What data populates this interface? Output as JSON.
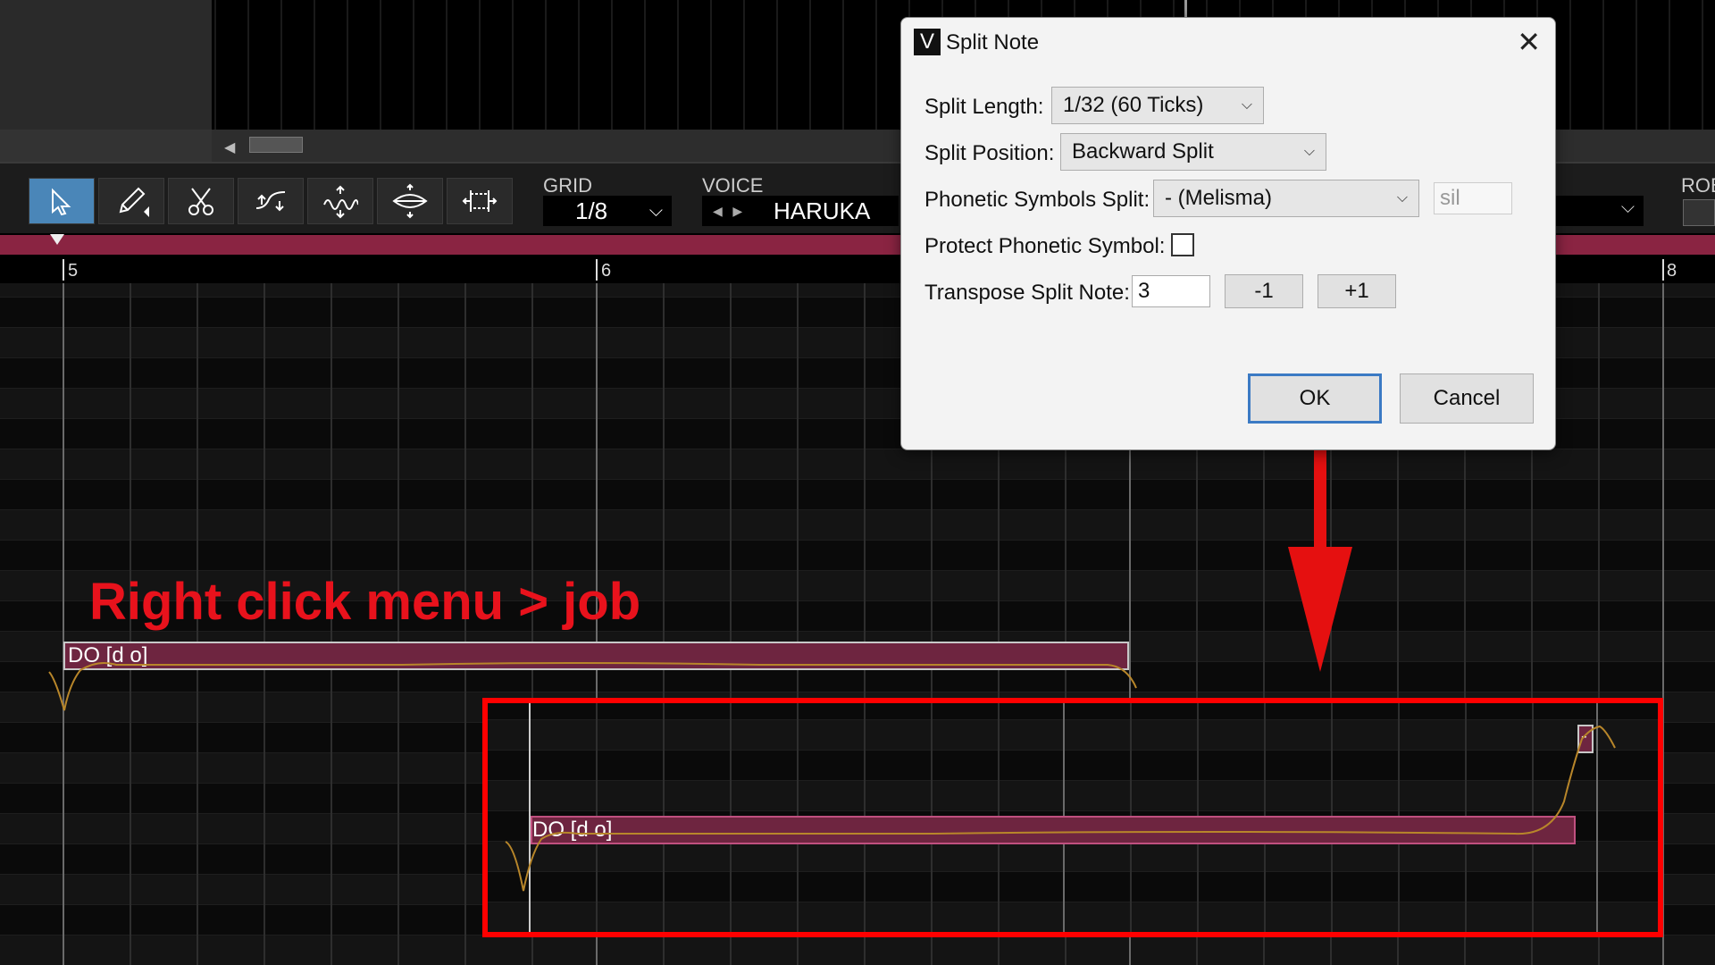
{
  "toolbar": {
    "grid_label": "GRID",
    "grid_value": "1/8",
    "voice_label": "VOICE",
    "voice_name": "HARUKA",
    "rob_label": "ROB"
  },
  "ruler": {
    "bar5": "5",
    "bar6": "6",
    "bar8": "8"
  },
  "notes": {
    "note1": "DO [d o]",
    "note2": "DO [d o]",
    "note3": "-"
  },
  "annotation": "Right click menu > job",
  "dialog": {
    "icon": "V",
    "title": "Split Note",
    "split_length_label": "Split Length:",
    "split_length_value": "1/32 (60 Ticks)",
    "split_position_label": "Split Position:",
    "split_position_value": "Backward Split",
    "phonetic_split_label": "Phonetic Symbols Split:",
    "phonetic_split_value": "- (Melisma)",
    "phonetic_split_extra": "sil",
    "protect_label": "Protect Phonetic Symbol:",
    "transpose_label": "Transpose Split Note:",
    "transpose_value": "3",
    "minus_label": "-1",
    "plus_label": "+1",
    "ok_label": "OK",
    "cancel_label": "Cancel"
  },
  "icons": [
    "pointer-icon",
    "pencil-icon",
    "scissors-icon",
    "pitch-curve-icon",
    "vibrato-icon",
    "dynamics-icon",
    "stretch-icon",
    "close-icon",
    "chevron-down-icon"
  ]
}
